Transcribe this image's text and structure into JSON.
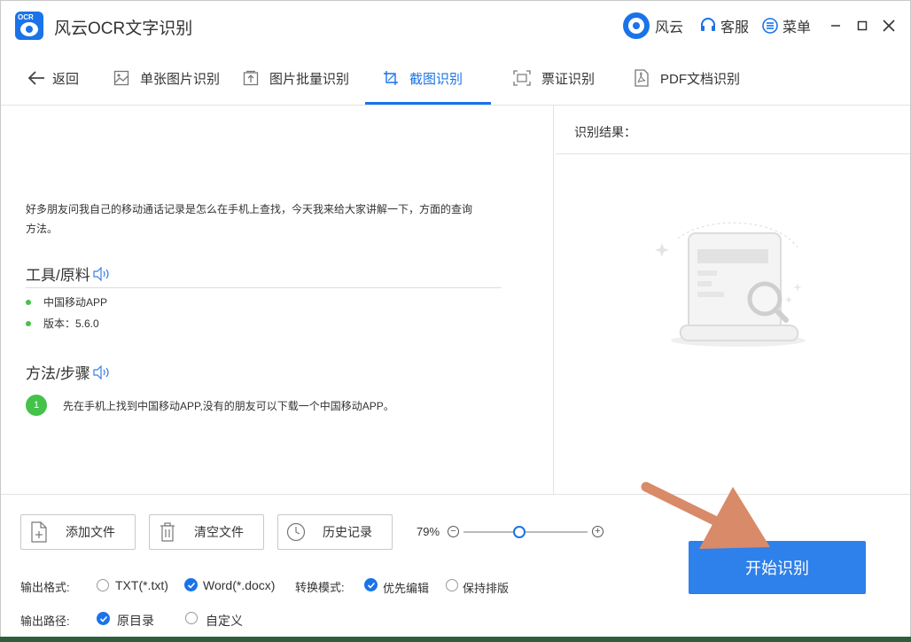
{
  "titlebar": {
    "app_title": "风云OCR文字识别",
    "brand_label": "风云",
    "service_label": "客服",
    "menu_label": "菜单"
  },
  "nav": {
    "back_label": "返回",
    "tabs": [
      {
        "label": "单张图片识别",
        "icon": "image-icon"
      },
      {
        "label": "图片批量识别",
        "icon": "upload-icon"
      },
      {
        "label": "截图识别",
        "icon": "crop-icon"
      },
      {
        "label": "票证识别",
        "icon": "scan-icon"
      },
      {
        "label": "PDF文档识别",
        "icon": "pdf-icon"
      }
    ],
    "active_tab": "截图识别"
  },
  "document": {
    "intro_line1": "好多朋友问我自己的移动通话记录是怎么在手机上查找，今天我来给大家讲解一下，方面的查询",
    "intro_line2": "方法。",
    "tools_heading": "工具/原料",
    "tools": [
      "中国移动APP",
      "版本：5.6.0"
    ],
    "steps_heading": "方法/步骤",
    "steps": [
      {
        "num": "1",
        "text": "先在手机上找到中国移动APP,没有的朋友可以下载一个中国移动APP。"
      }
    ]
  },
  "result": {
    "label": "识别结果："
  },
  "toolbar": {
    "add_file": "添加文件",
    "clear_file": "清空文件",
    "history": "历史记录",
    "zoom": "79%",
    "zoom_value": 0.45
  },
  "options": {
    "format_label": "输出格式:",
    "format_txt": "TXT(*.txt)",
    "format_word": "Word(*.docx)",
    "format_selected": "Word(*.docx)",
    "mode_label": "转换模式:",
    "mode_edit": "优先编辑",
    "mode_layout": "保持排版",
    "mode_selected": "优先编辑",
    "path_label": "输出路径:",
    "path_original": "原目录",
    "path_custom": "自定义",
    "path_selected": "原目录"
  },
  "start_button": "开始识别",
  "colors": {
    "accent": "#1a73e8",
    "start_button": "#2e80ea",
    "green": "#44c24a",
    "arrow": "#d98a68"
  }
}
